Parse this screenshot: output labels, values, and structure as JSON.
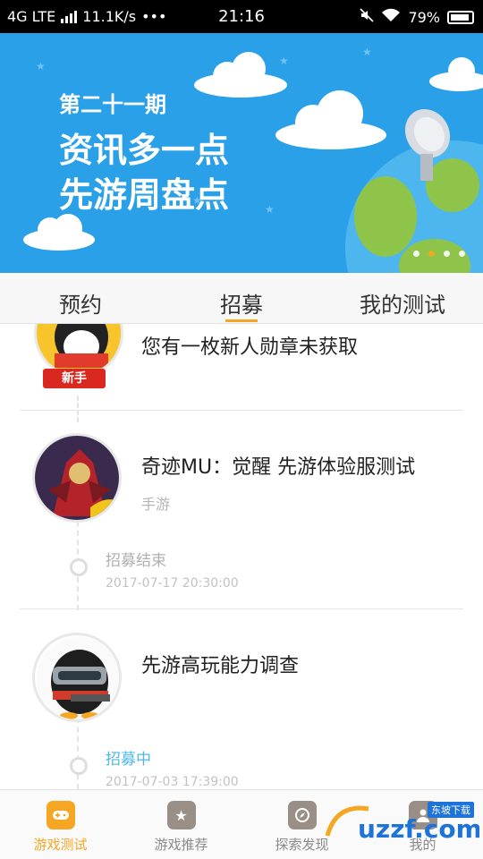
{
  "status_bar": {
    "network": "4G LTE",
    "speed": "11.1K/s",
    "dots": "•••",
    "time": "21:16",
    "battery": "79%"
  },
  "banner": {
    "issue": "第二十一期",
    "line1": "资讯多一点",
    "line2": "先游周盘点"
  },
  "tabs": [
    {
      "label": "预约"
    },
    {
      "label": "招募"
    },
    {
      "label": "我的测试"
    }
  ],
  "items": [
    {
      "title": "您有一枚新人勋章未获取",
      "badge": "新手"
    },
    {
      "title": "奇迹MU：觉醒 先游体验服测试",
      "tag": "手游",
      "status": "招募结束",
      "time": "2017-07-17 20:30:00"
    },
    {
      "title": "先游高玩能力调查",
      "status": "招募中",
      "time": "2017-07-03 17:39:00"
    }
  ],
  "bottom_nav": [
    {
      "label": "游戏测试",
      "icon": "gamepad-icon"
    },
    {
      "label": "游戏推荐",
      "icon": "star-icon"
    },
    {
      "label": "探索发现",
      "icon": "compass-icon"
    },
    {
      "label": "我的",
      "icon": "user-icon"
    }
  ],
  "watermark": {
    "text": "uzzf.com",
    "subtext": "东坡下载"
  },
  "colors": {
    "accent": "#f5a623",
    "banner": "#2aa0e8",
    "live": "#4db8e8"
  }
}
